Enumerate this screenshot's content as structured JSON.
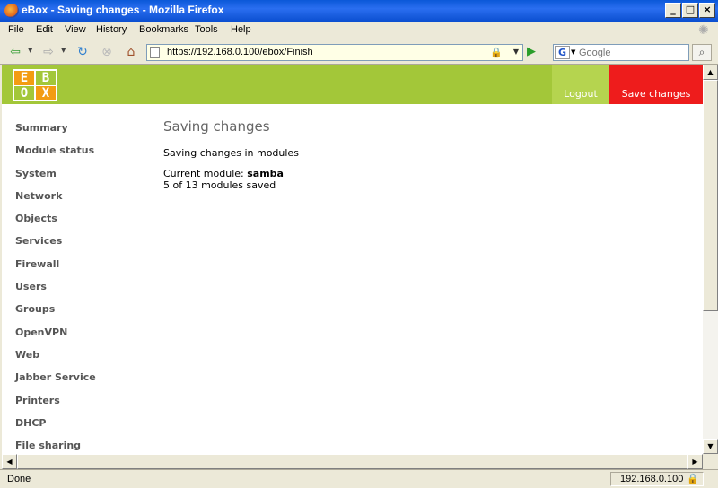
{
  "window": {
    "title": "eBox - Saving changes - Mozilla Firefox"
  },
  "menu": [
    "File",
    "Edit",
    "View",
    "History",
    "Bookmarks",
    "Tools",
    "Help"
  ],
  "navbar": {
    "url": "https://192.168.0.100/ebox/Finish",
    "search_placeholder": "Google"
  },
  "header": {
    "logo_letters": [
      "E",
      "B",
      "O",
      "X"
    ],
    "logout_label": "Logout",
    "save_label": "Save changes",
    "brand_green": "#a3c739",
    "save_red": "#ee1c1c"
  },
  "sidebar": {
    "items": [
      "Summary",
      "Module status",
      "System",
      "Network",
      "Objects",
      "Services",
      "Firewall",
      "Users",
      "Groups",
      "OpenVPN",
      "Web",
      "Jabber Service",
      "Printers",
      "DHCP",
      "File sharing"
    ]
  },
  "content": {
    "title": "Saving changes",
    "status_line": "Saving changes in modules",
    "current_module_label": "Current module:",
    "current_module": "samba",
    "progress_text": "5 of 13 modules saved",
    "modules_saved": 5,
    "modules_total": 13
  },
  "statusbar": {
    "text": "Done",
    "host": "192.168.0.100"
  }
}
